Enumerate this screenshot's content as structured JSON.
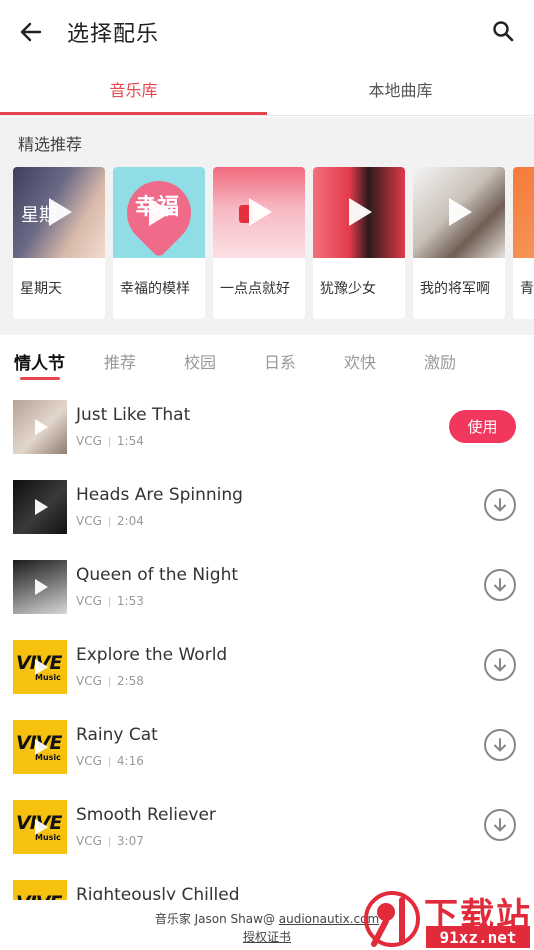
{
  "header": {
    "title": "选择配乐"
  },
  "tabs": [
    {
      "label": "音乐库",
      "active": true
    },
    {
      "label": "本地曲库",
      "active": false
    }
  ],
  "featured": {
    "title": "精选推荐",
    "cards": [
      {
        "label": "星期天",
        "thumb_text": "星期",
        "colors": [
          "#4a4a6a",
          "#c9a89a"
        ]
      },
      {
        "label": "幸福的模样",
        "thumb_text": "幸福",
        "colors": [
          "#8fdde6",
          "#f06a8a"
        ]
      },
      {
        "label": "一点点就好",
        "thumb_text": "",
        "colors": [
          "#f48a9a",
          "#fbd0d6"
        ]
      },
      {
        "label": "犹豫少女",
        "thumb_text": "",
        "colors": [
          "#e8424f",
          "#1a1a1a"
        ]
      },
      {
        "label": "我的将军啊",
        "thumb_text": "",
        "colors": [
          "#e6e6e6",
          "#7a6a60"
        ]
      },
      {
        "label": "青",
        "thumb_text": "",
        "colors": [
          "#f47a3a",
          "#f6a66a"
        ]
      }
    ]
  },
  "categories": [
    {
      "label": "情人节",
      "active": true
    },
    {
      "label": "推荐",
      "active": false
    },
    {
      "label": "校园",
      "active": false
    },
    {
      "label": "日系",
      "active": false
    },
    {
      "label": "欢快",
      "active": false
    },
    {
      "label": "激励",
      "active": false
    }
  ],
  "songs": [
    {
      "title": "Just Like That",
      "artist": "VCG",
      "duration": "1:54",
      "action": "使用",
      "thumb": "thumb-a"
    },
    {
      "title": "Heads Are Spinning",
      "artist": "VCG",
      "duration": "2:04",
      "action": "download",
      "thumb": "thumb-b"
    },
    {
      "title": "Queen of the Night",
      "artist": "VCG",
      "duration": "1:53",
      "action": "download",
      "thumb": "thumb-c"
    },
    {
      "title": "Explore the World",
      "artist": "VCG",
      "duration": "2:58",
      "action": "download",
      "thumb": "thumb-v"
    },
    {
      "title": "Rainy Cat",
      "artist": "VCG",
      "duration": "4:16",
      "action": "download",
      "thumb": "thumb-v"
    },
    {
      "title": "Smooth Reliever",
      "artist": "VCG",
      "duration": "3:07",
      "action": "download",
      "thumb": "thumb-v"
    },
    {
      "title": "Righteously Chilled",
      "artist": "",
      "duration": "",
      "action": "",
      "thumb": "thumb-v"
    }
  ],
  "thumb_logo": {
    "mark": "VIVE",
    "sub": "Music"
  },
  "footer": {
    "credit_prefix": "音乐家 Jason Shaw@ ",
    "credit_link": "audionautix.com",
    "license": "授权证书"
  },
  "watermark": {
    "text": "下载站",
    "url": "91xz.net"
  },
  "colors": {
    "accent": "#e8454e",
    "use_button": "#f2375e",
    "featured_bg": "#f2f2f2",
    "vive_yellow": "#f6c20f"
  }
}
